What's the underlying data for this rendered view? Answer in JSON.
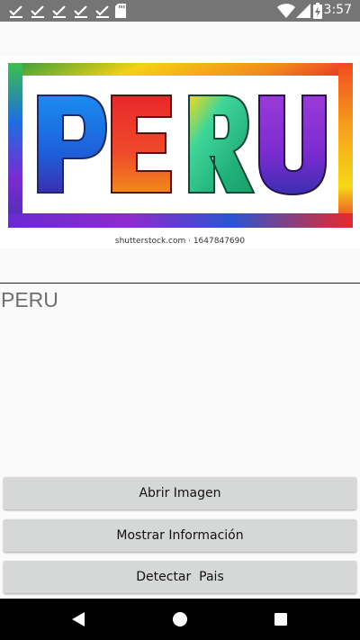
{
  "status_bar": {
    "time": "3:57",
    "notification_icons": [
      "check-icon",
      "check-icon",
      "check-icon",
      "check-icon",
      "check-icon",
      "sd-card-icon"
    ],
    "system_icons": [
      "wifi-icon",
      "signal-icon",
      "battery-charging-icon"
    ]
  },
  "image": {
    "logo_text": "PERU",
    "caption": "shutterstock.com · 1647847690"
  },
  "result": {
    "text": "PERU"
  },
  "buttons": {
    "open_image": "Abrir Imagen",
    "show_info": "Mostrar Información",
    "detect_country": "Detectar  Pais"
  },
  "nav_bar": {
    "icons": [
      "back-icon",
      "home-icon",
      "recents-icon"
    ]
  },
  "colors": {
    "status_bar": "#757575",
    "button_bg": "#d6d7d7",
    "result_text": "#6f6f6f"
  }
}
